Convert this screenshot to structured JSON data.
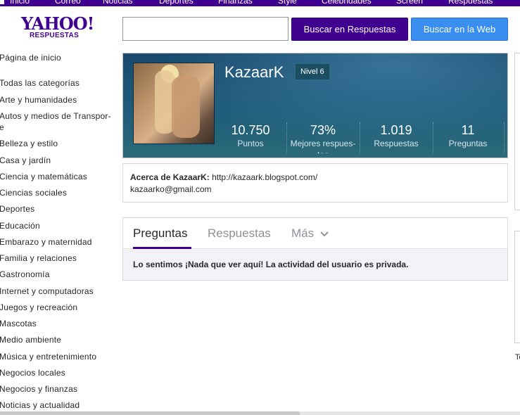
{
  "topnav": {
    "items": [
      "Inicio",
      "Correo",
      "Noticias",
      "Deportes",
      "Finanzas",
      "Style",
      "Celebridades",
      "Screen",
      "Respuestas"
    ]
  },
  "logo": {
    "main": "YAHOO!",
    "sub": "RESPUESTAS"
  },
  "search": {
    "value": "",
    "placeholder": "",
    "answers_button": "Buscar en Respuestas",
    "web_button": "Buscar en la Web"
  },
  "sidebar": {
    "items": [
      "Página de inicio",
      "Todas las categorías",
      "Arte y humanidades",
      "Autos y medios de Transpor-",
      "e",
      "Belleza y estilo",
      "Casa y jardín",
      "Ciencia y matemáticas",
      "Ciencias sociales",
      "Deportes",
      "Educación",
      "Embarazo y maternidad",
      "Familia y relaciones",
      "Gastronomía",
      "Internet y computadoras",
      "Juegos y recreación",
      "Mascotas",
      "Medio ambiente",
      "Música y entretenimiento",
      "Negocios locales",
      "Negocios y finanzas",
      "Noticias y actualidad"
    ]
  },
  "profile": {
    "username": "KazaarK",
    "level": "Nivel 6",
    "stats": [
      {
        "value": "10.750",
        "label": "Puntos"
      },
      {
        "value": "73%",
        "label": "Mejores respues-",
        "label2": "tas"
      },
      {
        "value": "1.019",
        "label": "Respuestas"
      },
      {
        "value": "11",
        "label": "Preguntas"
      }
    ]
  },
  "about": {
    "label": "Acerca de KazaarK:",
    "url": "http://kazaark.blogspot.com/",
    "email": "kazaarko@gmail.com"
  },
  "tabs": {
    "items": [
      "Preguntas",
      "Respuestas",
      "Más"
    ],
    "active": "Preguntas",
    "empty_message": "Lo sentimos ¡Nada que ver aquí! La actividad del usuario es privada."
  },
  "right_edge_text": "Te",
  "colors": {
    "brand": "#400090",
    "web_button": "#3a8ef0",
    "profile_bg": "#1e5a7a"
  }
}
